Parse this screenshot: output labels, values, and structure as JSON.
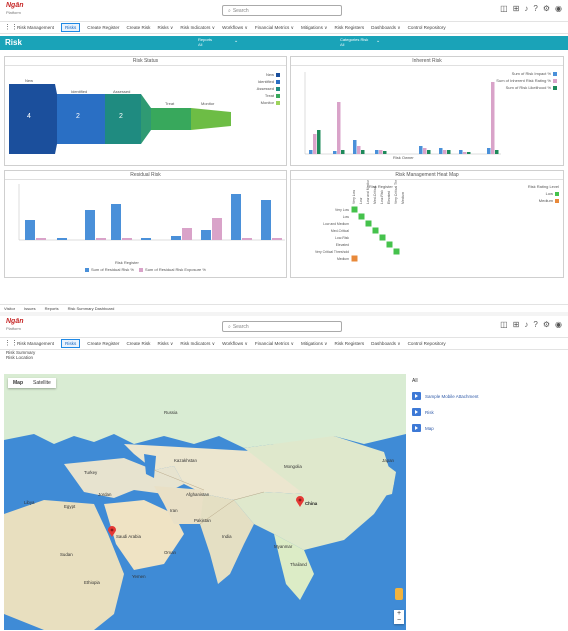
{
  "app": {
    "logo_line1": "Ngān",
    "logo_line2": "Platform"
  },
  "search": {
    "placeholder": "Search"
  },
  "toolbar": {
    "icons": [
      "panel-icon",
      "grid-icon",
      "bell-icon",
      "help-icon",
      "settings-icon",
      "user-icon"
    ]
  },
  "nav": {
    "items": [
      "Risk Management",
      "Risks",
      "Create Register",
      "Create Risk",
      "Risks ∨",
      "Risk Indicators ∨",
      "Workflows ∨",
      "Financial Metrics ∨",
      "Mitigations ∨",
      "Risk Registers",
      "Dashboards ∨",
      "Control Repository"
    ]
  },
  "risk_header": {
    "title": "Risk",
    "filter1_label": "Reports",
    "filter1_value": "All",
    "filter2_label": "Categories Risk",
    "filter2_value": "All"
  },
  "panels": {
    "risk_status": "Risk Status",
    "inherent_risk": "Inherent Risk",
    "residual_risk": "Residual Risk",
    "heatmap": "Risk Management Heat Map"
  },
  "funnel": {
    "stages": [
      {
        "label": "New",
        "value": "4"
      },
      {
        "label": "Identified",
        "value": "2"
      },
      {
        "label": "Assessed",
        "value": "2"
      },
      {
        "label": "Treat",
        "value": ""
      },
      {
        "label": "Monitor",
        "value": ""
      }
    ],
    "legend": [
      "New",
      "Identified",
      "Assessed",
      "Treat",
      "Monitor"
    ],
    "legend_colors": [
      "#1b4f9c",
      "#2a6fc4",
      "#1f8b80",
      "#38a85c",
      "#9dd35c"
    ]
  },
  "inherent_legend": [
    "Sum of Risk Impact %",
    "Sum of Inherent Risk Rating %",
    "Sum of Risk Likelihood %"
  ],
  "inherent_x_title": "Risk Owner",
  "residual_legend": [
    "Sum of Residual Risk %",
    "Sum of Residual Risk Exposure %"
  ],
  "residual_x_title": "Risk Register",
  "heatmap": {
    "title": "Risk Register",
    "rows": [
      "Very Low",
      "Low",
      "Low and Medium",
      "Med-Critical",
      "Low-Risk",
      "Elevated",
      "Very Critical Threshold",
      "Medium"
    ],
    "legend_title": "Risk Rating Level",
    "legend": [
      "Low",
      "Medium"
    ],
    "legend_colors": [
      "#45c24c",
      "#e8893a"
    ]
  },
  "colors": {
    "teal": "#1aa3b8",
    "bar_blue": "#4a90d9",
    "bar_pink": "#d9a3c9",
    "bar_green": "#1e8a5a",
    "heat_green": "#45c24c",
    "heat_orange": "#e8893a"
  },
  "status_bar": [
    "Visitor",
    "Issues",
    "Reports",
    "Risk Summary Dashboard"
  ],
  "map_page": {
    "subtitle1": "Risk Summary",
    "subtitle2": "Risk Location",
    "map_type": [
      "Map",
      "Satellite"
    ],
    "places": {
      "egypt": "Egypt",
      "jordan": "Jordan",
      "saudi": "Saudi Arabia",
      "iran": "Iran",
      "afghanistan": "Afghanistan",
      "pakistan": "Pakistan",
      "india": "India",
      "china": "China",
      "mongolia": "Mongolia",
      "kazakhstan": "Kazakhstan",
      "turkey": "Turkey",
      "russia": "Russia",
      "myanmar": "Myanmar",
      "thailand": "Thailand",
      "sudan": "Sudan",
      "ethiopia": "Ethiopia",
      "libya": "Libya",
      "oman": "Oman",
      "yemen": "Yemen",
      "japan": "Japan"
    },
    "files_header": "All",
    "files": [
      "Sample Mobile Attachment",
      "Risk",
      "Map"
    ]
  }
}
